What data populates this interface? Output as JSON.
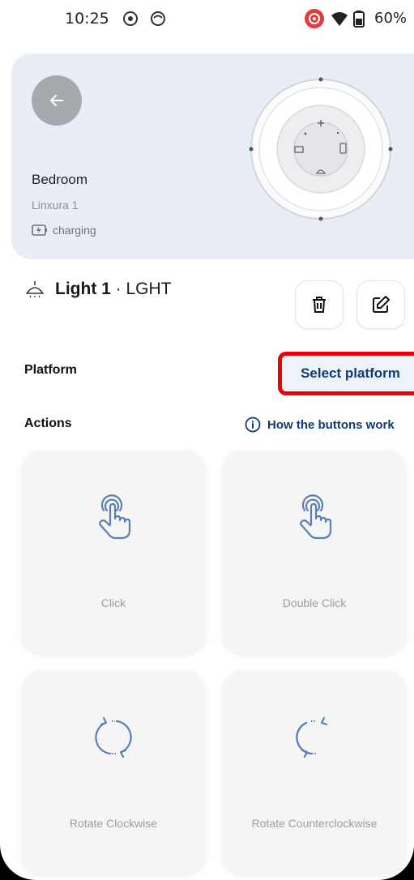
{
  "status_bar": {
    "time": "10:25",
    "battery": "60%"
  },
  "header_card": {
    "room": "Bedroom",
    "device": "Linxura 1",
    "battery_status": "charging"
  },
  "light": {
    "name": "Light 1",
    "separator": " · ",
    "code": "LGHT"
  },
  "platform": {
    "label": "Platform",
    "select_label": "Select platform"
  },
  "actions": {
    "label": "Actions",
    "help_link": "How the buttons work",
    "tiles": [
      {
        "label": "Click",
        "icon": "tap-icon"
      },
      {
        "label": "Double Click",
        "icon": "tap-icon"
      },
      {
        "label": "Rotate Clockwise",
        "icon": "rotate-clockwise-icon"
      },
      {
        "label": "Rotate Counterclockwise",
        "icon": "rotate-counterclockwise-icon"
      }
    ]
  },
  "colors": {
    "accent": "#0f3b75",
    "highlight_border": "#e8000b",
    "card_bg": "#e9eef6"
  }
}
